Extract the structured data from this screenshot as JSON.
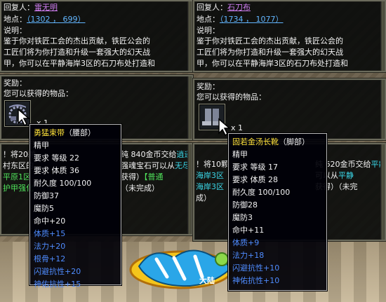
{
  "left_panel": {
    "reply_label": "回复人：",
    "npc_name": "雷无明",
    "location_label": "地点：",
    "coords": "（1302 ， 699）",
    "desc_label": "说明：",
    "desc_lines": [
      "鉴于你对铁匠工会的杰出贡献，铁匠公会的",
      "工匠们将为你打造和升级一套强大的幻天战",
      "甲，你可以在平静海岸3区的石刀布处打造和"
    ],
    "reward_label": "奖励：",
    "reward_sub": "您可以获得的物品：",
    "reward_qty": "x 1",
    "quest_frag": {
      "row1_a": "！将20颗",
      "row1_b": "纯 840金币交给",
      "row1_c": "逍遥",
      "row2_a": "村东区的",
      "row2_b": "强魂宝石可以从",
      "row2_c": "无尽",
      "row3_a": "平原1区",
      "row3_b": "获得）",
      "row3_c": "【普通",
      "row4_a": "护甲强化",
      "row4_b": "（未完成）"
    }
  },
  "right_panel": {
    "reply_label": "回复人：",
    "npc_name": "石刀布",
    "location_label": "地点：",
    "coords": "（1734 ， 1077）",
    "desc_label": "说明：",
    "desc_lines": [
      "鉴于你对铁匠工会的杰出贡献，铁匠公会的",
      "工匠们将为你打造和升级一套强大的幻天战",
      "甲，你可以在平静海岸3区的石刀布处打造和"
    ],
    "reward_label": "奖励：",
    "reward_sub": "您可以获得的物品：",
    "reward_qty": "x 1",
    "quest_frag": {
      "row1_a": "！将10颗",
      "row1_b": "纯 620金币交给",
      "row1_c": "平静",
      "row2_a": "海岸3区",
      "row2_b": "可以从",
      "row2_c": "平静",
      "row3_a": "海岸3区",
      "row3_b": "获得）",
      "row3_c": "（未完",
      "row4_a": "成）"
    }
  },
  "tooltip_left": {
    "title": "勇猛束带",
    "slot": "（腰部）",
    "quality": "精甲",
    "req_level_label": "要求 等级",
    "req_level": "22",
    "req_con_label": "要求 体质",
    "req_con": "36",
    "durability": "耐久度 100/100",
    "def": "防御37",
    "mdef": "魔防5",
    "hit": "命中+20",
    "blue_stats": [
      "体质+15",
      "法力+20",
      "根骨+12",
      "闪避抗性+20",
      "神佑抗性+15"
    ]
  },
  "tooltip_right": {
    "title": "固若金汤长靴",
    "slot": "（脚部）",
    "quality": "精甲",
    "req_level_label": "要求 等级",
    "req_level": "17",
    "req_con_label": "要求 体质",
    "req_con": "28",
    "durability": "耐久度 100/100",
    "def": "防御28",
    "mdef": "魔防3",
    "hit": "命中+11",
    "blue_stats": [
      "体质+9",
      "法力+18",
      "闪避抗性+10",
      "神佑抗性+10"
    ]
  },
  "logo": {
    "text": "大陆"
  },
  "colors": {
    "npc_name": "#d27ff4",
    "coords": "#62b6ff",
    "item_title": "#ffe23a",
    "blue_stat": "#4f8cff"
  }
}
